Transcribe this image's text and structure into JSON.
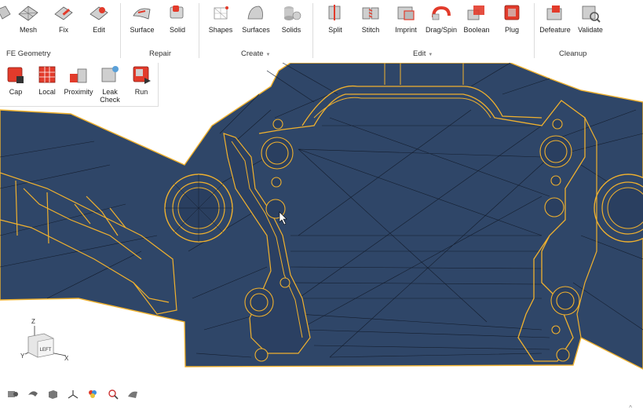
{
  "ribbon": {
    "fe_geometry": {
      "label": "FE Geometry",
      "tools": [
        "Mesh",
        "Fix",
        "Edit"
      ]
    },
    "repair": {
      "label": "Repair",
      "tools": [
        "Surface",
        "Solid"
      ]
    },
    "create": {
      "label": "Create",
      "tools": [
        "Shapes",
        "Surfaces",
        "Solids"
      ]
    },
    "edit": {
      "label": "Edit",
      "tools": [
        "Split",
        "Stitch",
        "Imprint",
        "Drag/Spin",
        "Boolean",
        "Plug"
      ]
    },
    "cleanup": {
      "label": "Cleanup",
      "tools": [
        "Defeature",
        "Validate"
      ]
    }
  },
  "subpanel": {
    "tools": [
      "Cap",
      "Local",
      "Proximity",
      "Leak\nCheck",
      "Run"
    ]
  },
  "triad": {
    "z": "Z",
    "y": "Y",
    "x": "X",
    "face": "LEFT"
  },
  "bottom_tools": [
    "view-icon",
    "swap-icon",
    "cube-icon",
    "axis-icon",
    "color-icon",
    "search-icon",
    "render-icon"
  ],
  "corner_caret": "^",
  "colors": {
    "model": "#2f4668",
    "edges": "#f0b12e",
    "mesh_lines": "#141d2d",
    "accent": "#e23b2b"
  }
}
